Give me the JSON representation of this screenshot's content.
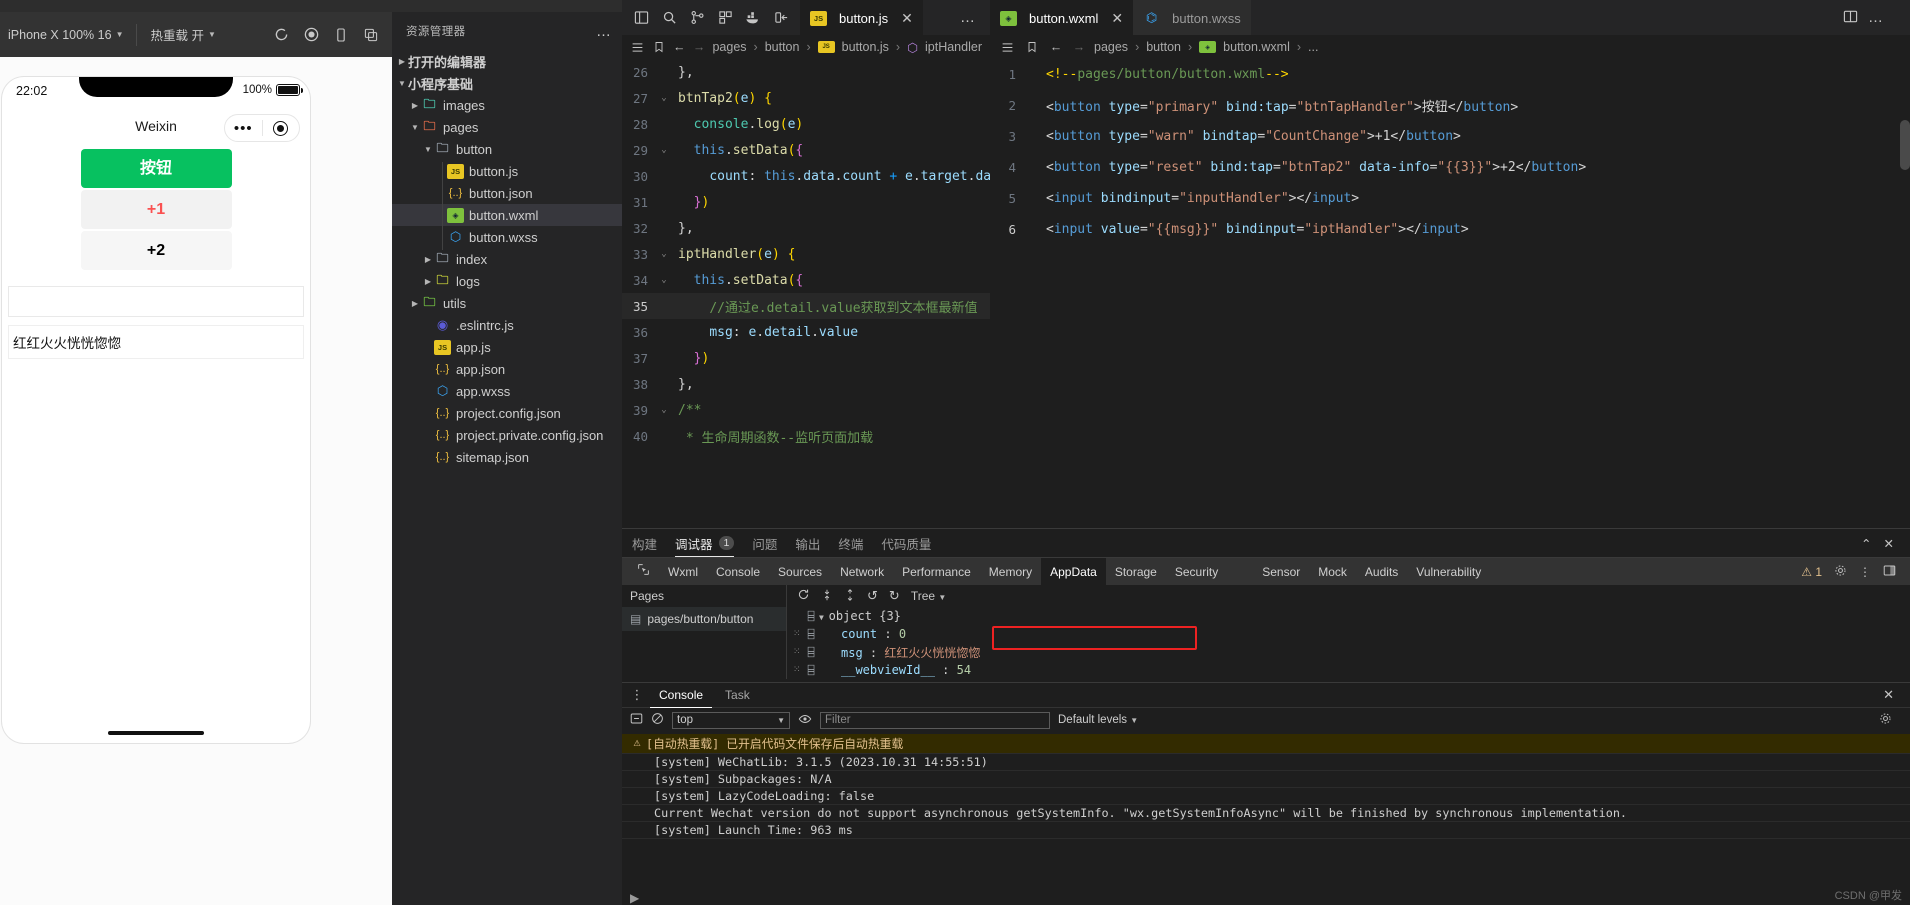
{
  "simulator": {
    "toolbar": {
      "device": "iPhone X 100% 16",
      "hotreload": "热重载 开",
      "refresh_icon": "refresh-icon",
      "stop_icon": "stop-record-icon",
      "phone_icon": "device-icon",
      "copy_icon": "duplicate-icon"
    },
    "status": {
      "time": "22:02",
      "battery_pct": "100%"
    },
    "nav_title": "Weixin",
    "capsule": {
      "dots": "•••",
      "target": "target-icon"
    },
    "buttons": [
      {
        "label": "按钮",
        "style": "primary"
      },
      {
        "label": "+1",
        "style": "warn"
      },
      {
        "label": "+2",
        "style": "reset"
      }
    ],
    "input_value": "",
    "text_value": "红红火火恍恍惚惚"
  },
  "explorer": {
    "title": "资源管理器",
    "more": "…",
    "items": [
      {
        "label": "打开的编辑器",
        "depth": 0,
        "twisty": "▶",
        "icon": "",
        "selected": false
      },
      {
        "label": "小程序基础",
        "depth": 0,
        "twisty": "▼",
        "icon": "",
        "selected": false
      },
      {
        "label": "images",
        "depth": 1,
        "twisty": "▶",
        "icon": "folder-images",
        "selected": false
      },
      {
        "label": "pages",
        "depth": 1,
        "twisty": "▼",
        "icon": "folder-pages",
        "selected": false
      },
      {
        "label": "button",
        "depth": 2,
        "twisty": "▼",
        "icon": "folder",
        "selected": false
      },
      {
        "label": "button.js",
        "depth": 3,
        "twisty": "",
        "icon": "js",
        "selected": false
      },
      {
        "label": "button.json",
        "depth": 3,
        "twisty": "",
        "icon": "json",
        "selected": false
      },
      {
        "label": "button.wxml",
        "depth": 3,
        "twisty": "",
        "icon": "wxml",
        "selected": true
      },
      {
        "label": "button.wxss",
        "depth": 3,
        "twisty": "",
        "icon": "wxss",
        "selected": false
      },
      {
        "label": "index",
        "depth": 2,
        "twisty": "▶",
        "icon": "folder",
        "selected": false
      },
      {
        "label": "logs",
        "depth": 2,
        "twisty": "▶",
        "icon": "folder-logs",
        "selected": false
      },
      {
        "label": "utils",
        "depth": 1,
        "twisty": "▶",
        "icon": "folder-utils",
        "selected": false
      },
      {
        "label": ".eslintrc.js",
        "depth": 2,
        "twisty": "",
        "icon": "eslint",
        "selected": false
      },
      {
        "label": "app.js",
        "depth": 2,
        "twisty": "",
        "icon": "js",
        "selected": false
      },
      {
        "label": "app.json",
        "depth": 2,
        "twisty": "",
        "icon": "json",
        "selected": false
      },
      {
        "label": "app.wxss",
        "depth": 2,
        "twisty": "",
        "icon": "wxss",
        "selected": false
      },
      {
        "label": "project.config.json",
        "depth": 2,
        "twisty": "",
        "icon": "json",
        "selected": false
      },
      {
        "label": "project.private.config.json",
        "depth": 2,
        "twisty": "",
        "icon": "json",
        "selected": false
      },
      {
        "label": "sitemap.json",
        "depth": 2,
        "twisty": "",
        "icon": "json",
        "selected": false
      }
    ]
  },
  "editor_js": {
    "tab": {
      "label": "button.js",
      "icon": "js-file-icon",
      "close": "✕"
    },
    "breadcrumb": [
      "pages",
      "button",
      "button.js",
      "iptHandler"
    ],
    "more": "…",
    "lines": [
      {
        "n": "26",
        "fold": "",
        "hl": false
      },
      {
        "n": "27",
        "fold": "⌄",
        "hl": false
      },
      {
        "n": "28",
        "fold": "",
        "hl": false
      },
      {
        "n": "29",
        "fold": "⌄",
        "hl": false
      },
      {
        "n": "30",
        "fold": "",
        "hl": false
      },
      {
        "n": "31",
        "fold": "",
        "hl": false
      },
      {
        "n": "32",
        "fold": "",
        "hl": false
      },
      {
        "n": "33",
        "fold": "⌄",
        "hl": false
      },
      {
        "n": "34",
        "fold": "⌄",
        "hl": false
      },
      {
        "n": "35",
        "fold": "",
        "hl": true
      },
      {
        "n": "36",
        "fold": "",
        "hl": false
      },
      {
        "n": "37",
        "fold": "",
        "hl": false
      },
      {
        "n": "38",
        "fold": "",
        "hl": false
      },
      {
        "n": "39",
        "fold": "⌄",
        "hl": false
      },
      {
        "n": "40",
        "fold": "",
        "hl": false
      }
    ],
    "code_text": [
      "},",
      "btnTap2(e) {",
      "console.log(e)",
      "this.setData({",
      "count: this.data.count + e.target.dataset.info",
      "})",
      "},",
      "iptHandler(e) {",
      "this.setData({",
      "//通过e.detail.value获取到文本框最新值",
      "msg: e.detail.value",
      "})",
      "},",
      "/**",
      "* 生命周期函数--监听页面加载"
    ]
  },
  "editor_wxml": {
    "tabs": [
      {
        "label": "button.wxml",
        "icon": "wxml-file-icon",
        "active": true,
        "close": "✕"
      },
      {
        "label": "button.wxss",
        "icon": "wxss-file-icon",
        "active": false,
        "close": ""
      }
    ],
    "breadcrumb": [
      "pages",
      "button",
      "button.wxml",
      "..."
    ],
    "window_controls": [
      "split-editor-icon",
      "more-actions-icon"
    ],
    "lines": [
      {
        "n": "1",
        "text": "<!--pages/button/button.wxml-->"
      },
      {
        "n": "2",
        "text": "<button type=\"primary\" bind:tap=\"btnTapHandler\">按钮</button>"
      },
      {
        "n": "3",
        "text": "<button type=\"warn\" bindtap=\"CountChange\">+1</button>"
      },
      {
        "n": "4",
        "text": "<button type=\"reset\" bind:tap=\"btnTap2\" data-info=\"{{3}}\">+2</button>"
      },
      {
        "n": "5",
        "text": "<input bindinput=\"inputHandler\"></input>"
      },
      {
        "n": "6",
        "text": "<input value=\"{{msg}}\" bindinput=\"iptHandler\"></input>"
      }
    ]
  },
  "debugger": {
    "panel_tabs": [
      {
        "label": "构建",
        "active": false,
        "badge": ""
      },
      {
        "label": "调试器",
        "active": true,
        "badge": "1"
      },
      {
        "label": "问题",
        "active": false,
        "badge": ""
      },
      {
        "label": "输出",
        "active": false,
        "badge": ""
      },
      {
        "label": "终端",
        "active": false,
        "badge": ""
      },
      {
        "label": "代码质量",
        "active": false,
        "badge": ""
      }
    ],
    "panel_controls": [
      "chevron-up-icon",
      "close-icon"
    ],
    "devtools_tabs": [
      {
        "label": "Wxml",
        "active": false
      },
      {
        "label": "Console",
        "active": false
      },
      {
        "label": "Sources",
        "active": false
      },
      {
        "label": "Network",
        "active": false
      },
      {
        "label": "Performance",
        "active": false
      },
      {
        "label": "Memory",
        "active": false
      },
      {
        "label": "AppData",
        "active": true
      },
      {
        "label": "Storage",
        "active": false
      },
      {
        "label": "Security",
        "active": false
      },
      {
        "label": "Sensor",
        "active": false
      },
      {
        "label": "Mock",
        "active": false
      },
      {
        "label": "Audits",
        "active": false
      },
      {
        "label": "Vulnerability",
        "active": false
      }
    ],
    "devtools_right": {
      "warn_count": "1",
      "gear": "gear-icon",
      "kebab": "more-icon",
      "dock": "dock-icon"
    },
    "appdata": {
      "pages_header": "Pages",
      "pages_items": [
        "pages/button/button"
      ],
      "toolbar": {
        "refresh": "refresh-icon",
        "expand": "expand-icon",
        "collapse": "collapse-icon",
        "undo": "undo-icon",
        "redo": "redo-icon",
        "mode": "Tree"
      },
      "tree": [
        {
          "key": "object",
          "val": "{3}",
          "indent": 0,
          "twisty": "▼",
          "highlight": false
        },
        {
          "key": "count",
          "val": "0",
          "indent": 1,
          "twisty": "",
          "highlight": false
        },
        {
          "key": "msg",
          "val": "红红火火恍恍惚惚",
          "indent": 1,
          "twisty": "",
          "highlight": true
        },
        {
          "key": "__webviewId__",
          "val": "54",
          "indent": 1,
          "twisty": "",
          "highlight": false
        }
      ]
    }
  },
  "console": {
    "tabs": [
      {
        "label": "Console",
        "active": true
      },
      {
        "label": "Task",
        "active": false
      }
    ],
    "close": "✕",
    "filterbar": {
      "record_icon": "record-icon",
      "clear_icon": "clear-icon",
      "context": "top",
      "eye_icon": "eye-icon",
      "filter_placeholder": "Filter",
      "levels": "Default levels",
      "settings_icon": "settings-icon"
    },
    "messages": [
      {
        "text": "[自动热重载] 已开启代码文件保存后自动热重载",
        "level": "warn",
        "icon": "⚠"
      },
      {
        "text": "[system] WeChatLib: 3.1.5 (2023.10.31 14:55:51)",
        "level": "info",
        "icon": ""
      },
      {
        "text": "[system] Subpackages: N/A",
        "level": "info",
        "icon": ""
      },
      {
        "text": "[system] LazyCodeLoading: false",
        "level": "info",
        "icon": ""
      },
      {
        "text": "Current Wechat version do not support asynchronous getSystemInfo. \"wx.getSystemInfoAsync\" will be finished by synchronous implementation.",
        "level": "info",
        "icon": ""
      },
      {
        "text": "[system] Launch Time: 963 ms",
        "level": "info",
        "icon": ""
      }
    ],
    "prompt": "▶"
  },
  "watermark": "CSDN @甲发",
  "colors": {
    "accent_green": "#07c160",
    "warn_red": "#fa5151",
    "highlight_red": "#ee2222",
    "editor_bg": "#1e1e1e"
  }
}
